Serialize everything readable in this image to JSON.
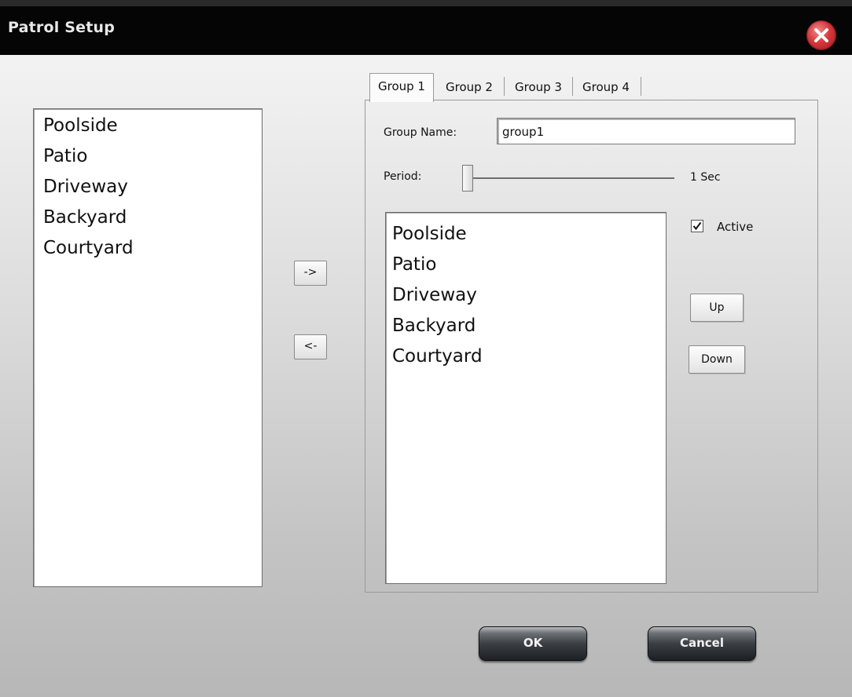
{
  "window": {
    "title": "Patrol Setup"
  },
  "available_cameras": [
    "Poolside",
    "Patio",
    "Driveway",
    "Backyard",
    "Courtyard"
  ],
  "transfer": {
    "add_label": "->",
    "remove_label": "<-"
  },
  "tabs": [
    {
      "label": "Group 1",
      "active": true
    },
    {
      "label": "Group 2",
      "active": false
    },
    {
      "label": "Group 3",
      "active": false
    },
    {
      "label": "Group 4",
      "active": false
    }
  ],
  "group": {
    "name_label": "Group Name:",
    "name_value": "group1",
    "period_label": "Period:",
    "period_value_text": "1 Sec",
    "period_fraction": 0.0,
    "active_label": "Active",
    "active_checked": true,
    "cameras": [
      "Poolside",
      "Patio",
      "Driveway",
      "Backyard",
      "Courtyard"
    ],
    "up_label": "Up",
    "down_label": "Down"
  },
  "footer": {
    "ok_label": "OK",
    "cancel_label": "Cancel"
  },
  "colors": {
    "close_button": "#d6363a",
    "titlebar": "#050505"
  }
}
